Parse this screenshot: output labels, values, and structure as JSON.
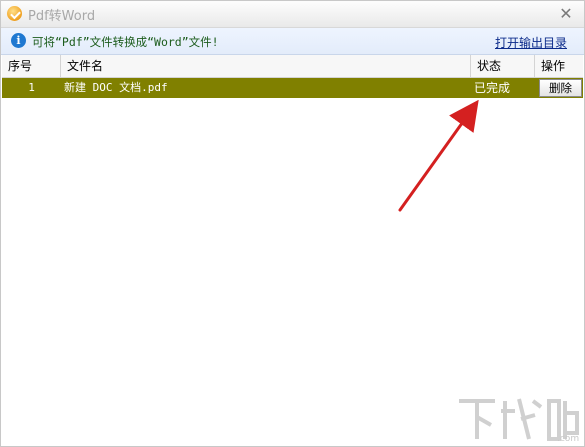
{
  "window": {
    "title": "Pdf转Word",
    "close_glyph": "✕"
  },
  "infobar": {
    "message": "可将“Pdf”文件转换成“Word”文件!",
    "link_label": "打开输出目录"
  },
  "table": {
    "columns": [
      "序号",
      "文件名",
      "状态",
      "操作"
    ],
    "rows": [
      {
        "index": "1",
        "filename": "新建 DOC 文档.pdf",
        "status": "已完成",
        "action": "删除"
      }
    ],
    "selected_row_color": "#808000"
  },
  "annotation": {
    "arrow_color": "#d42020"
  },
  "watermark": {
    "text": "下载吧"
  }
}
